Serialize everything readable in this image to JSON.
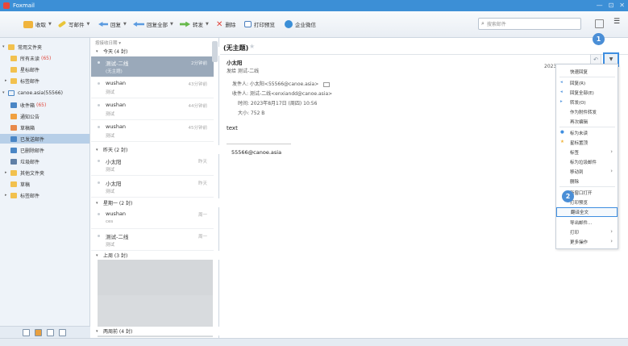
{
  "window": {
    "title": "Foxmail",
    "controls": [
      "—",
      "⊡",
      "✕"
    ]
  },
  "toolbar": {
    "receive": "收取",
    "compose": "写邮件",
    "reply": "回复",
    "reply_all": "回复全部",
    "forward": "转发",
    "delete": "删除",
    "print_preview": "打印预览",
    "enterprise_wechat": "企业微信",
    "search_placeholder": "搜索邮件"
  },
  "sidebar": {
    "common_folder": "常用文件夹",
    "all_unread": "所有未读",
    "all_unread_count": "(65)",
    "starred": "星标邮件",
    "tagged": "标签邮件",
    "account": "canoe.asia(55566)",
    "inbox": "收件箱",
    "inbox_count": "(65)",
    "notice": "通知公告",
    "drafts": "草稿箱",
    "sent": "已发送邮件",
    "deleted": "已删除邮件",
    "junk": "垃圾邮件",
    "other_folders": "其他文件夹",
    "drafts2": "草稿",
    "tagged2": "标签邮件"
  },
  "list": {
    "sort_label": "按接收日期 ▾",
    "groups": {
      "today": "今天 (4 封)",
      "yesterday": "昨天 (2 封)",
      "monday": "星期一 (2 封)",
      "last_week": "上周 (3 封)",
      "two_weeks": "两周前 (4 封)"
    },
    "messages": [
      {
        "from": "测试-二线",
        "subject": "(无主题)",
        "time": "2分钟前"
      },
      {
        "from": "wushan",
        "subject": "测试",
        "time": "43分钟前"
      },
      {
        "from": "wushan",
        "subject": "测试",
        "time": "44分钟前"
      },
      {
        "from": "wushan",
        "subject": "测试",
        "time": "45分钟前"
      },
      {
        "from": "小太阳",
        "subject": "测试",
        "time": "昨天"
      },
      {
        "from": "小太阳",
        "subject": "测试",
        "time": "昨天"
      },
      {
        "from": "wushan",
        "subject": "ces",
        "time": "周一"
      },
      {
        "from": "测试-二线",
        "subject": "测试",
        "time": "周一"
      }
    ]
  },
  "reader": {
    "title": "(无主题)",
    "sender_name": "小太阳",
    "sender_to": "发给 测试-二线",
    "from_line": "发件人: 小太阳<55566@canoe.asia>",
    "to_line": "收件人: 测试-二线<enxiandd@canoe.asia>",
    "time_line": "时间: 2023年8月17日 (周四) 10:56",
    "size_line": "大小: 752 B",
    "date_short": "2023-",
    "body": "text",
    "signature": "55566@canoe.asia"
  },
  "menu": {
    "quick_reply": "快速回复",
    "reply": "回复(R)",
    "reply_all": "回复全部(E)",
    "forward": "转发(O)",
    "as_attachment": "作为附件转发",
    "reedit": "再次编辑",
    "mark_unread": "标为未读",
    "star": "星标置顶",
    "tag": "标签",
    "mark_junk": "标为垃圾邮件",
    "move_to": "移动到",
    "delete": "删除",
    "open_new_window": "新窗口打开",
    "print_preview": "打印预览",
    "translate": "翻译全文",
    "export": "导出邮件...",
    "print": "打印",
    "more": "更多操作"
  },
  "badges": {
    "one": "1",
    "two": "2"
  },
  "colors": {
    "accent": "#3e8ee0",
    "title_bar": "#3c8fd6",
    "unread_count": "#e0463b"
  }
}
